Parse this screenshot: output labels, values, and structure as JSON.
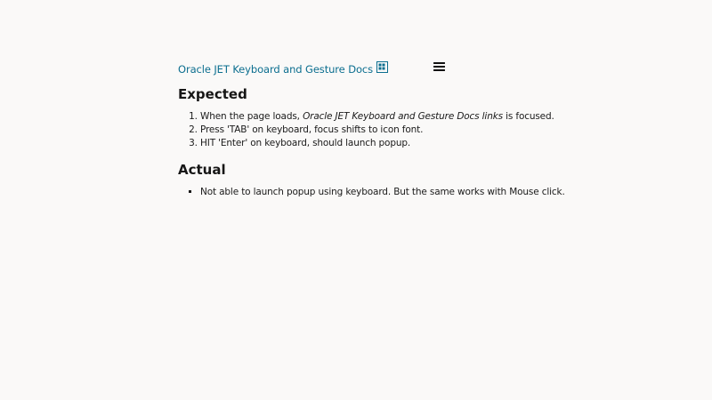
{
  "header": {
    "doc_link_label": "Oracle JET Keyboard and Gesture Docs",
    "grid_icon": "grid-icon",
    "menu_icon": "hamburger-menu-icon"
  },
  "expected": {
    "heading": "Expected",
    "steps": [
      {
        "prefix": "When the page loads, ",
        "emphasis": "Oracle JET Keyboard and Gesture Docs links",
        "suffix": " is focused."
      },
      {
        "text": "Press 'TAB' on keyboard, focus shifts to icon font."
      },
      {
        "text": "HIT 'Enter' on keyboard, should launch popup."
      }
    ]
  },
  "actual": {
    "heading": "Actual",
    "items": [
      {
        "text": "Not able to launch popup using keyboard. But the same works with Mouse click."
      }
    ]
  },
  "colors": {
    "link": "#0b6e8f",
    "background": "#faf9f8",
    "text": "#1a1a1a"
  }
}
